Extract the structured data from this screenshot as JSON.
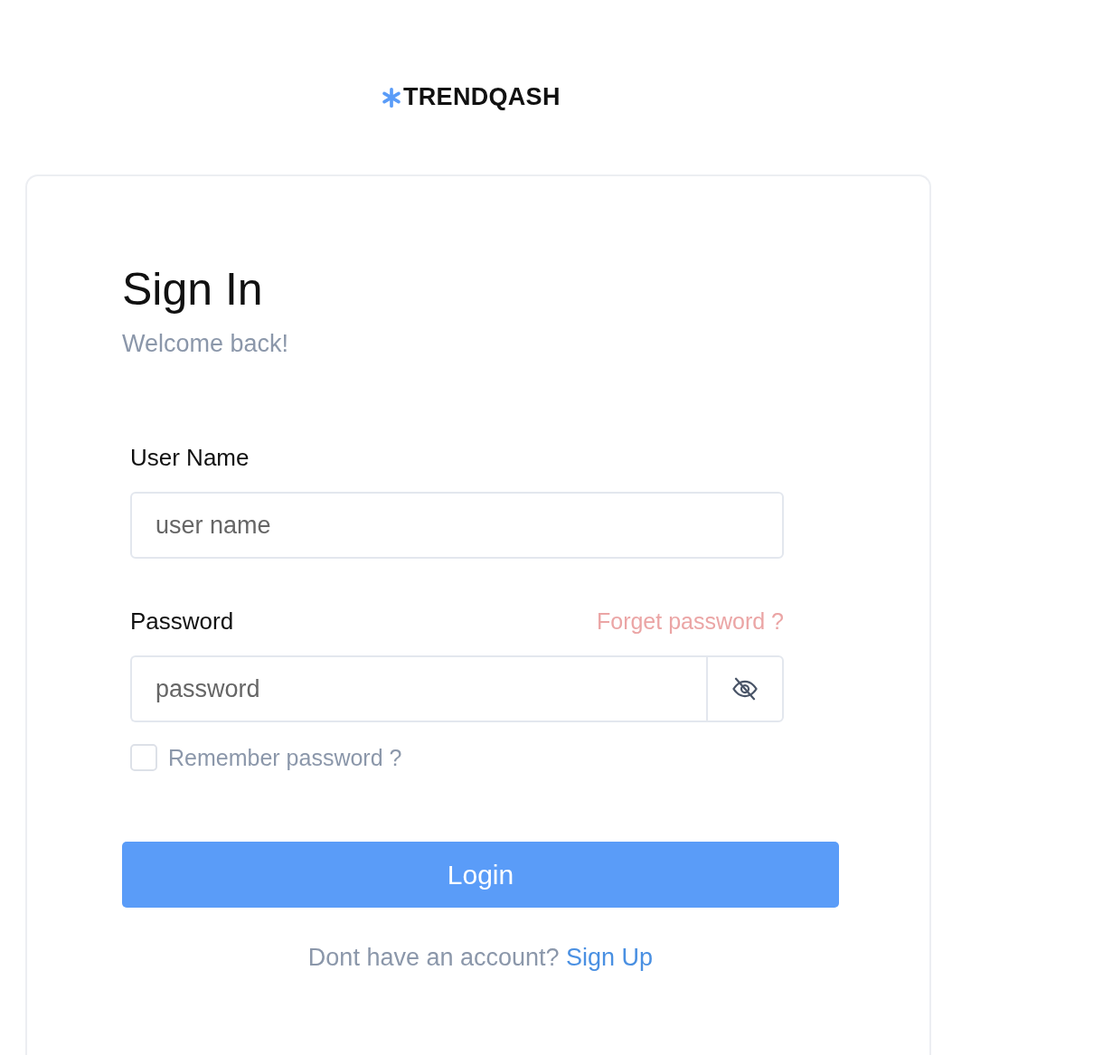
{
  "logo": {
    "text": "TRENDQASH"
  },
  "title": "Sign In",
  "subtitle": "Welcome back!",
  "username": {
    "label": "User Name",
    "placeholder": "user name"
  },
  "password": {
    "label": "Password",
    "link": "Forget password ?",
    "placeholder": "password"
  },
  "remember": {
    "label": "Remember password ?",
    "checked": false
  },
  "login_button": "Login",
  "footer": {
    "text": "Dont have an account?",
    "link": "Sign Up"
  }
}
